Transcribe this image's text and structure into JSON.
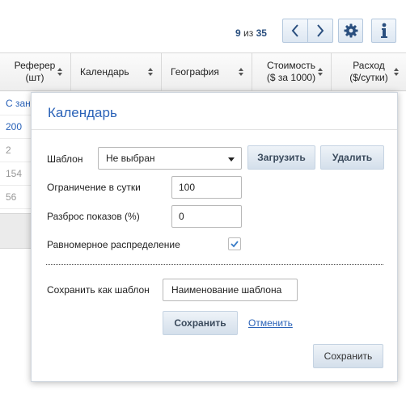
{
  "pager": {
    "current": "9",
    "of_label": "из",
    "total": "35"
  },
  "icons": {
    "prev": "chevron-left-icon",
    "next": "chevron-right-icon",
    "settings": "gear-icon",
    "info": "info-icon"
  },
  "table": {
    "headers": [
      {
        "line1": "Реферер",
        "line2": "(шт)"
      },
      {
        "line1": "Календарь",
        "line2": ""
      },
      {
        "line1": "География",
        "line2": ""
      },
      {
        "line1": "Стоимость",
        "line2": "($ за 1000)"
      },
      {
        "line1": "Расход",
        "line2": "($/сутки)"
      }
    ],
    "first_column": [
      "С зан",
      "200",
      "2",
      "154",
      "56"
    ]
  },
  "modal": {
    "title": "Календарь",
    "template_label": "Шаблон",
    "template_value": "Не выбран",
    "load_button": "Загрузить",
    "delete_button": "Удалить",
    "daily_limit_label": "Ограничение в сутки",
    "daily_limit_value": "100",
    "spread_label": "Разброс показов (%)",
    "spread_value": "0",
    "uniform_label": "Равномерное распределение",
    "uniform_checked": true,
    "save_as_template_label": "Сохранить как шаблон",
    "template_name_value": "Наименование шаблона",
    "save_template_button": "Сохранить",
    "cancel_link": "Отменить",
    "save_button": "Сохранить"
  },
  "colors": {
    "accent": "#2a62b8",
    "check": "#3a7dc8"
  }
}
